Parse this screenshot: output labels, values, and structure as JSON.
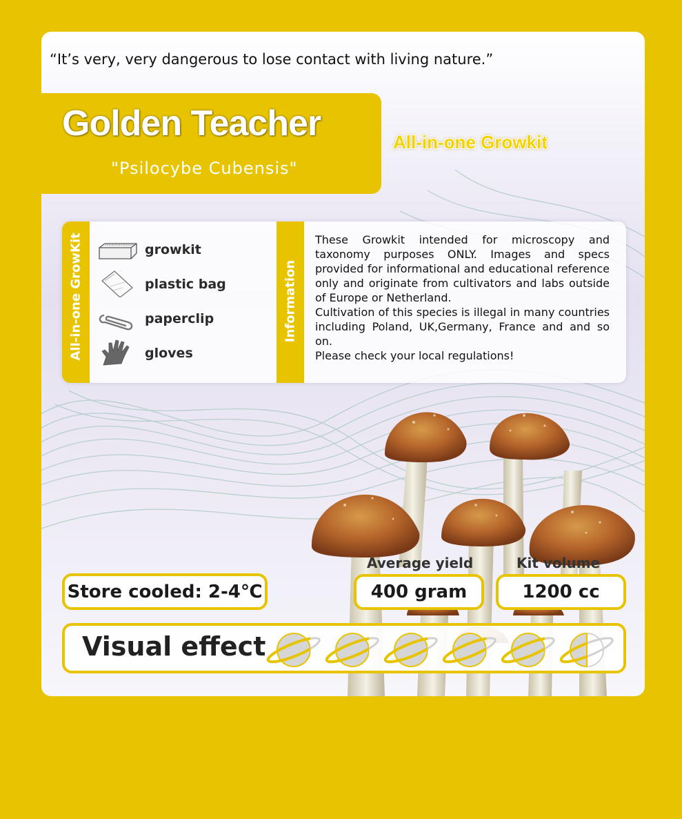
{
  "quote": "“It’s very, very dangerous to lose contact with living nature.”",
  "product": {
    "title": "Golden Teacher",
    "subtitle": "\"Psilocybe Cubensis\"",
    "tagline": "All-in-one Growkit"
  },
  "kit": {
    "heading": "All-in-one GrowKit",
    "items": [
      {
        "label": "growkit",
        "icon": "box-icon"
      },
      {
        "label": "plastic bag",
        "icon": "bag-icon"
      },
      {
        "label": "paperclip",
        "icon": "paperclip-icon"
      },
      {
        "label": "gloves",
        "icon": "glove-icon"
      }
    ]
  },
  "info": {
    "heading": "Information",
    "paragraphs": [
      "These Growkit intended for microscopy and taxonomy purposes ONLY. Images and specs provided for informational and educational reference only and originate from cultivators and labs outside of Europe or Netherland.",
      "Cultivation of this species is illegal in many countries including Poland, UK,Germany, France and and so on.",
      "Please check your local regulations!"
    ]
  },
  "stats": {
    "store": "Store cooled: 2-4℃",
    "yield_label": "Average yield",
    "yield_value": "400 gram",
    "volume_label": "Kit volume",
    "volume_value": "1200 cc"
  },
  "visual_effect": {
    "label": "Visual effect",
    "rating": 5.5,
    "max": 6
  },
  "colors": {
    "accent": "#e8c400",
    "text": "#1a1a1a"
  }
}
